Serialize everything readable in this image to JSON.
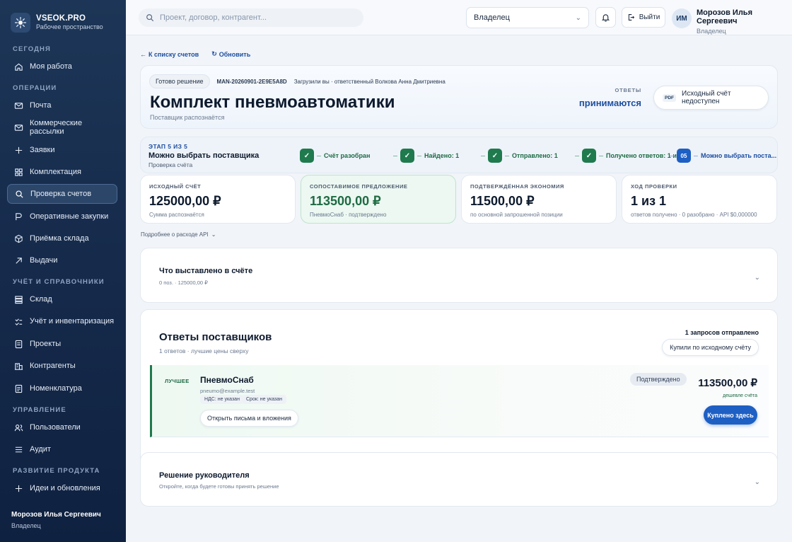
{
  "brand": {
    "name": "VSEOK.PRO",
    "subtitle": "Рабочее пространство"
  },
  "sidebar": {
    "sections": [
      {
        "label": "СЕГОДНЯ"
      },
      {
        "label": "ОПЕРАЦИИ"
      },
      {
        "label": "УЧЁТ И СПРАВОЧНИКИ"
      },
      {
        "label": "УПРАВЛЕНИЕ"
      },
      {
        "label": "РАЗВИТИЕ ПРОДУКТА"
      }
    ],
    "items": [
      {
        "label": "Моя работа",
        "icon": "home-icon"
      },
      {
        "label": "Почта",
        "icon": "mail-icon"
      },
      {
        "label": "Коммерческие рассылки",
        "icon": "mail-icon"
      },
      {
        "label": "Заявки",
        "icon": "plus-icon"
      },
      {
        "label": "Комплектация",
        "icon": "grid-icon"
      },
      {
        "label": "Проверка счетов",
        "icon": "search-icon",
        "active": true
      },
      {
        "label": "Оперативные закупки",
        "icon": "cart-icon"
      },
      {
        "label": "Приёмка склада",
        "icon": "box-icon"
      },
      {
        "label": "Выдачи",
        "icon": "arrow-icon"
      },
      {
        "label": "Склад",
        "icon": "stack-icon"
      },
      {
        "label": "Учёт и инвентаризация",
        "icon": "check-icon"
      },
      {
        "label": "Проекты",
        "icon": "folder-icon"
      },
      {
        "label": "Контрагенты",
        "icon": "building-icon"
      },
      {
        "label": "Номенклатура",
        "icon": "doc-icon"
      },
      {
        "label": "Пользователи",
        "icon": "users-icon"
      },
      {
        "label": "Аудит",
        "icon": "list-icon"
      },
      {
        "label": "Идеи и обновления",
        "icon": "plus-icon"
      }
    ],
    "user": {
      "name": "Морозов Илья Сергеевич",
      "role": "Владелец"
    }
  },
  "topbar": {
    "search_placeholder": "Проект, договор, контрагент...",
    "role_select": "Владелец",
    "logout_label": "Выйти",
    "avatar_initials": "ИМ",
    "user_name": "Морозов Илья Сергеевич",
    "user_role": "Владелец"
  },
  "nav": {
    "back_label": "К списку счетов",
    "refresh_label": "Обновить"
  },
  "header": {
    "status_chip": "Готово решение",
    "code": "MAN-20260901-2E9E5A8D",
    "uploaded_by": "Загрузили вы · ответственный Волкова Анна Дмитриевна",
    "title": "Комплект пневмоавтоматики",
    "subtitle": "Поставщик распознаётся",
    "answers_label": "ОТВЕТЫ",
    "answers_value": "принимаются",
    "pdf_tag": "PDF",
    "pdf_button": "Исходный счёт недоступен"
  },
  "stage": {
    "step_label": "ЭТАП 5 ИЗ 5",
    "title": "Можно выбрать поставщика",
    "subtitle": "Проверка счёта",
    "steps": [
      {
        "label": "Счёт разобран",
        "mark": "✓"
      },
      {
        "label": "Найдено: 1",
        "mark": "✓"
      },
      {
        "label": "Отправлено: 1",
        "mark": "✓"
      },
      {
        "label": "Получено ответов: 1 и...",
        "mark": "✓"
      },
      {
        "label": "Можно выбрать поста...",
        "mark": "05"
      }
    ]
  },
  "metrics": [
    {
      "label": "ИСХОДНЫЙ СЧЁТ",
      "value": "125000,00 ₽",
      "sub": "Сумма распознаётся"
    },
    {
      "label": "СОПОСТАВИМОЕ ПРЕДЛОЖЕНИЕ",
      "value": "113500,00 ₽",
      "sub": "ПневмоСнаб · подтверждено"
    },
    {
      "label": "ПОДТВЕРЖДЁННАЯ ЭКОНОМИЯ",
      "value": "11500,00 ₽",
      "sub": "по основной запрошенной позиции"
    },
    {
      "label": "ХОД ПРОВЕРКИ",
      "value": "1 из 1",
      "sub": "ответов получено · 0 разобрано · API $0,000000"
    }
  ],
  "api_details": "Подробнее о расходе API",
  "invoice_section": {
    "title": "Что выставлено в счёте",
    "subtitle": "0 поз. · 125000,00 ₽"
  },
  "responses": {
    "title": "Ответы поставщиков",
    "subtitle": "1 ответов · лучшие цены сверху",
    "requests_sent": "1 запросов отправлено",
    "bought_original": "Купили по исходному счёту",
    "offer": {
      "badge": "ЛУЧШЕЕ",
      "supplier": "ПневмоСнаб",
      "email": "pneumo@example.test",
      "vat": "НДС: не указан",
      "term": "Срок: не указан",
      "open_label": "Открыть письма и вложения",
      "status": "Подтверждено",
      "price": "113500,00 ₽",
      "price_note": "дешевле счёта",
      "buy_label": "Куплено здесь"
    }
  },
  "decision": {
    "title": "Решение руководителя",
    "subtitle": "Откройте, когда будете готовы принять решение"
  },
  "colors": {
    "sidebar": "#15294a",
    "accent": "#1e5fc4",
    "success": "#1f7a4d"
  }
}
